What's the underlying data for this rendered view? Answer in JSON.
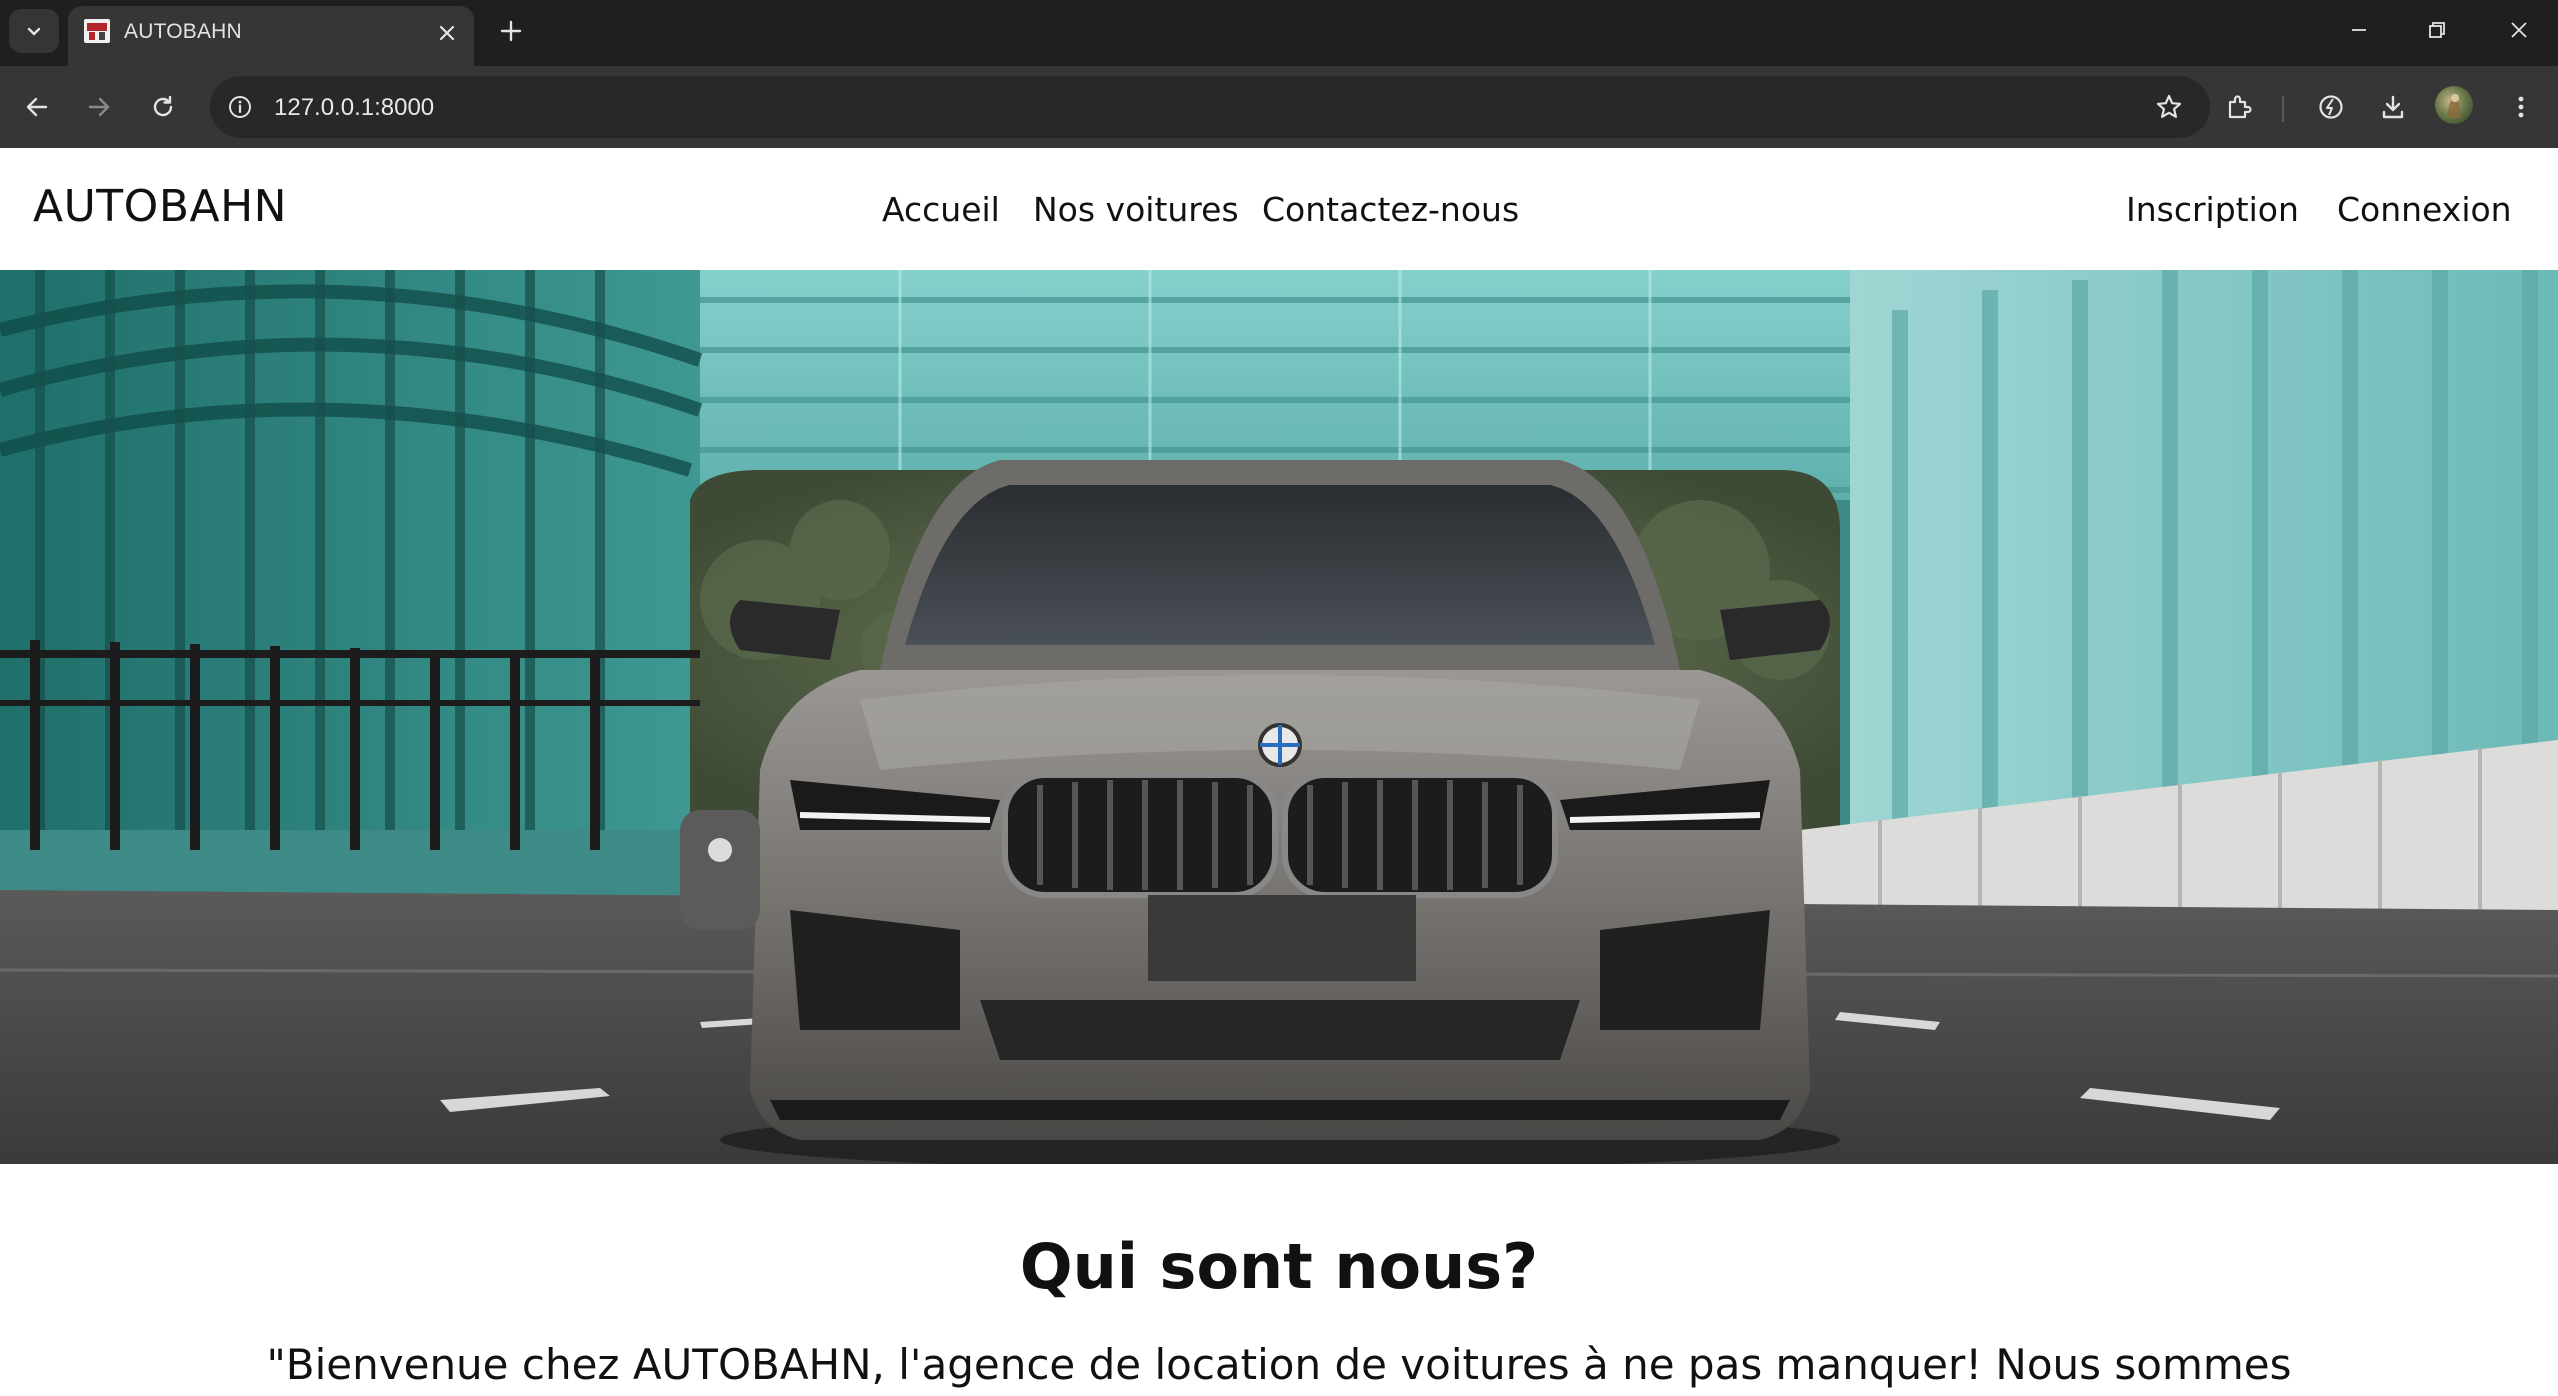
{
  "browser": {
    "tab_title": "AUTOBAHN",
    "url": "127.0.0.1:8000"
  },
  "site": {
    "brand": "AUTOBAHN",
    "nav_links": [
      "Accueil",
      "Nos voitures",
      "Contactez-nous"
    ],
    "auth_links": [
      "Inscription",
      "Connexion"
    ]
  },
  "about": {
    "title": "Qui sont nous?",
    "intro": "\"Bienvenue chez AUTOBAHN, l'agence de location de voitures à ne pas manquer! Nous sommes"
  },
  "colors": {
    "tabbar": "#1f1f1f",
    "toolbar": "#363636",
    "tunnel_teal": "#7fc4c4"
  },
  "icons": [
    "tab-search-icon",
    "favicon-icon",
    "close-icon",
    "plus-icon",
    "minimize-icon",
    "restore-icon",
    "window-close-icon",
    "back-arrow-icon",
    "forward-arrow-icon",
    "reload-icon",
    "info-icon",
    "star-icon",
    "extensions-icon",
    "performance-icon",
    "download-icon",
    "menu-dots-icon"
  ]
}
